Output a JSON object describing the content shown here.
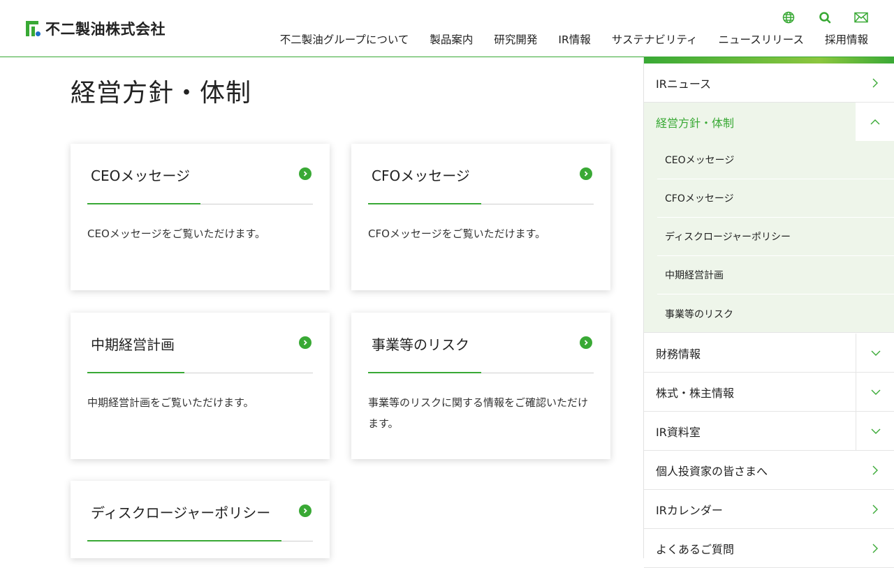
{
  "header": {
    "logo_text": "不二製油株式会社",
    "nav": [
      "不二製油グループについて",
      "製品案内",
      "研究開発",
      "IR情報",
      "サステナビリティ",
      "ニュースリリース",
      "採用情報"
    ],
    "icons": [
      "globe-icon",
      "search-icon",
      "mail-icon"
    ],
    "accent_color": "#39a935"
  },
  "main": {
    "title": "経営方針・体制",
    "cards": [
      {
        "title": "CEOメッセージ",
        "desc": "CEOメッセージをご覧いただけます。",
        "accent": 0.5
      },
      {
        "title": "CFOメッセージ",
        "desc": "CFOメッセージをご覧いただけます。",
        "accent": 0.5
      },
      {
        "title": "中期経営計画",
        "desc": "中期経営計画をご覧いただけます。",
        "accent": 0.43
      },
      {
        "title": "事業等のリスク",
        "desc": "事業等のリスクに関する情報をご確認いただけます。",
        "accent": 0.5
      },
      {
        "title": "ディスクロージャーポリシー",
        "desc": "",
        "accent": 0.86
      }
    ]
  },
  "sidebar": {
    "items": [
      {
        "label": "IRニュース",
        "toggle": "chevron-right-icon"
      },
      {
        "label": "経営方針・体制",
        "toggle": "chevron-up-icon",
        "active": true
      },
      {
        "label": "財務情報",
        "toggle": "chevron-down-icon"
      },
      {
        "label": "株式・株主情報",
        "toggle": "chevron-down-icon"
      },
      {
        "label": "IR資料室",
        "toggle": "chevron-down-icon"
      },
      {
        "label": "個人投資家の皆さまへ",
        "toggle": "chevron-right-icon"
      },
      {
        "label": "IRカレンダー",
        "toggle": "chevron-right-icon"
      },
      {
        "label": "よくあるご質問",
        "toggle": "chevron-right-icon"
      }
    ],
    "sub_items": [
      "CEOメッセージ",
      "CFOメッセージ",
      "ディスクロージャーポリシー",
      "中期経営計画",
      "事業等のリスク"
    ]
  }
}
